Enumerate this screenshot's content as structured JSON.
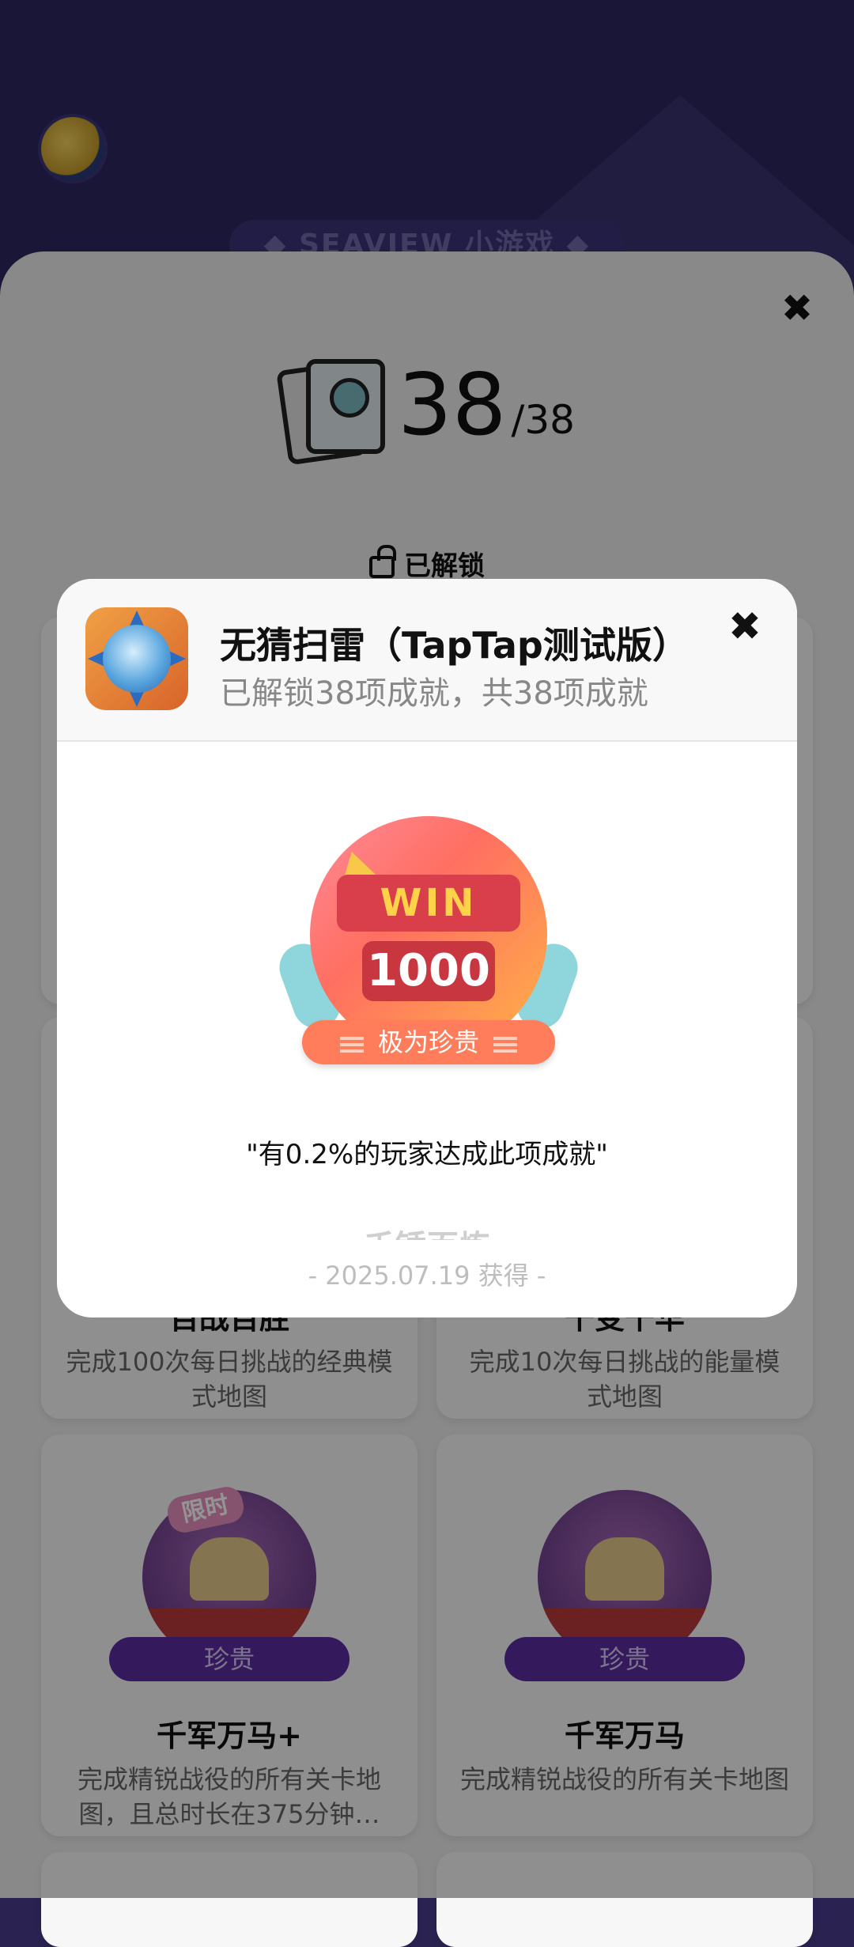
{
  "header": {
    "brand": "◆ SEAVIEW 小游戏 ◆"
  },
  "progress": {
    "current": "38",
    "total": "/38",
    "unlock_label": "已解锁"
  },
  "cards": [
    {
      "title": "百战百胜",
      "description": "完成100次每日挑战的经典模式地图"
    },
    {
      "title": "千变千华",
      "description": "完成10次每日挑战的能量模式地图"
    },
    {
      "title": "千军万马+",
      "description": "完成精锐战役的所有关卡地图，且总时长在375分钟…",
      "rarity": "珍贵",
      "tag": "限时"
    },
    {
      "title": "千军万马",
      "description": "完成精锐战役的所有关卡地图",
      "rarity": "珍贵"
    }
  ],
  "modal": {
    "game_title": "无猜扫雷（TapTap测试版）",
    "subtitle": "已解锁38项成就，共38项成就",
    "badge": {
      "line1": "WIN",
      "line2": "1000",
      "rarity": "极为珍贵"
    },
    "quote": "\"有0.2%的玩家达成此项成就\"",
    "achievement_name": "千锤百炼",
    "obtained": "- 2025.07.19 获得 -"
  },
  "icons": [
    "close-icon",
    "lock-open-icon",
    "cards-icon",
    "game-icon"
  ],
  "colors": {
    "header_bg": "#2d2660",
    "rarity_purple": "#5b2ea0",
    "rarity_orange": "#ff7d5a"
  }
}
